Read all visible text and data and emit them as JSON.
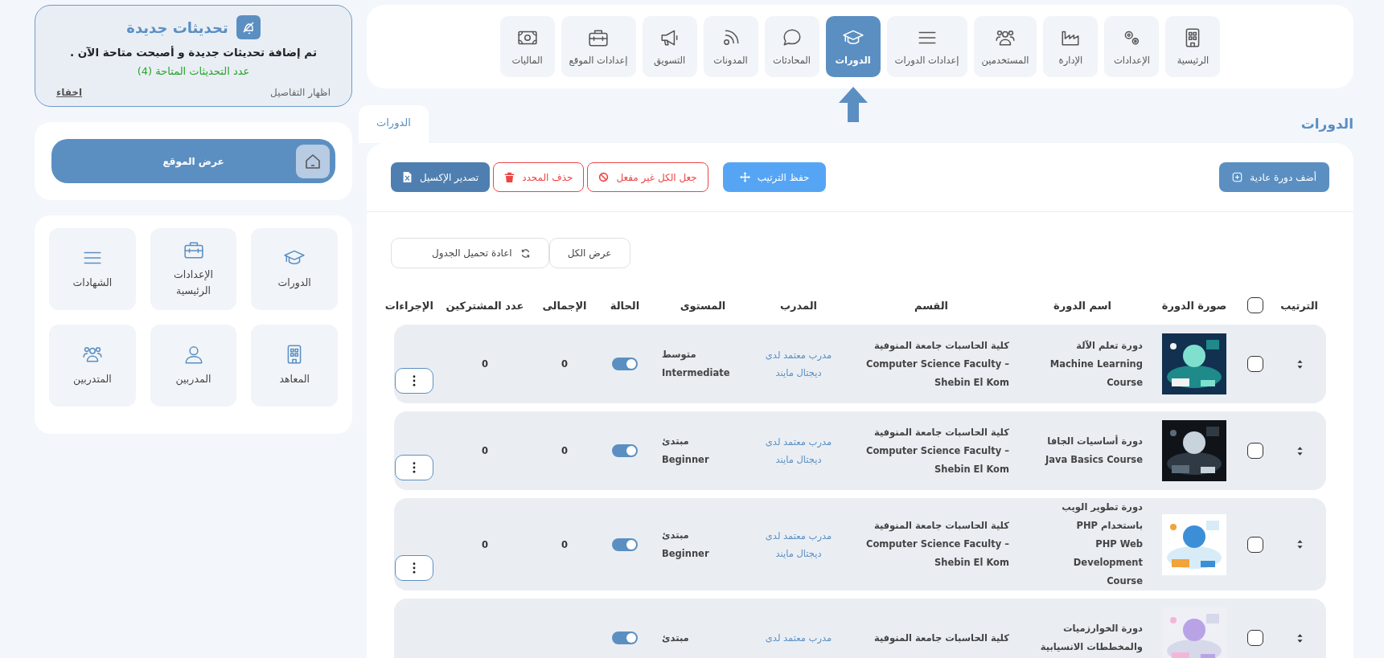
{
  "nav": [
    {
      "label": "الرئيسية",
      "selected": false
    },
    {
      "label": "الإعدادات",
      "selected": false
    },
    {
      "label": "الإدارة",
      "selected": false
    },
    {
      "label": "المستخدمين",
      "selected": false
    },
    {
      "label": "إعدادات الدورات",
      "selected": false
    },
    {
      "label": "الدورات",
      "selected": true
    },
    {
      "label": "المحادثات",
      "selected": false
    },
    {
      "label": "المدونات",
      "selected": false
    },
    {
      "label": "التسويق",
      "selected": false
    },
    {
      "label": "إعدادات الموقع",
      "selected": false
    },
    {
      "label": "الماليات",
      "selected": false
    }
  ],
  "page_title": "الدورات",
  "breadcrumb_tab": "الدورات",
  "toolbar": {
    "add": "أضف دورة عادية",
    "save_order": "حفظ الترتيب",
    "disable_all": "جعل الكل غير مفعل",
    "delete_selected": "حذف المحدد",
    "export": "تصدير الإكسيل"
  },
  "filters": {
    "show_all": "عرض الكل",
    "reload": "اعادة تحميل الجدول"
  },
  "table": {
    "columns": [
      "الترتيب",
      "صورة الدورة",
      "اسم الدورة",
      "القسم",
      "المدرب",
      "المستوى",
      "الحالة",
      "الإجمالى",
      "عدد المشتركين",
      "الإجراءات"
    ],
    "header_checked": false,
    "rows": [
      {
        "checked": false,
        "image": {
          "kind": "picture"
        },
        "name": [
          "دورة تعلم الآلة",
          "Machine Learning Course"
        ],
        "department": [
          "كلية الحاسبات جامعة المنوفية",
          "Computer Science Faculty – Shebin El Kom"
        ],
        "trainer": "مدرب معتمد لدى ديجتال مايند",
        "level": [
          "متوسط",
          "Intermediate"
        ],
        "on": true,
        "total": "0",
        "participants": "0"
      },
      {
        "checked": false,
        "image": {
          "kind": "picture"
        },
        "name": [
          "دورة أساسيات الجافا",
          "Java Basics Course"
        ],
        "department": [
          "كلية الحاسبات جامعة المنوفية",
          "Computer Science Faculty – Shebin El Kom"
        ],
        "trainer": "مدرب معتمد لدى ديجتال مايند",
        "level": [
          "مبتدئ",
          "Beginner"
        ],
        "on": true,
        "total": "0",
        "participants": "0"
      },
      {
        "checked": false,
        "image": {
          "kind": "picture"
        },
        "name": [
          "دورة تطوير الويب باستخدام PHP",
          "PHP Web Development Course"
        ],
        "department": [
          "كلية الحاسبات جامعة المنوفية",
          "Computer Science Faculty – Shebin El Kom"
        ],
        "trainer": "مدرب معتمد لدى ديجتال مايند",
        "level": [
          "مبتدئ",
          "Beginner"
        ],
        "on": true,
        "total": "0",
        "participants": "0"
      },
      {
        "checked": false,
        "image": {
          "kind": "picture"
        },
        "name": [
          "دورة الخوارزميات والمخططات الانسيابية"
        ],
        "department": [
          "كلية الحاسبات جامعة المنوفية"
        ],
        "trainer": "مدرب معتمد لدى",
        "level": [
          "مبتدئ"
        ],
        "on": true
      }
    ]
  },
  "updates": {
    "title": "تحديثات جديدة",
    "message": "تم إضافة تحديثات جديدة و أصبحت متاحة الآن .",
    "count": "عدد التحديثات المتاحة (4)",
    "details": "اظهار التفاصيل",
    "hide": "اخفاء"
  },
  "view_site": "عرض الموقع",
  "shortcuts": [
    "الدورات",
    "الإعدادات الرئيسية",
    "الشهادات",
    "المعاهد",
    "المدربين",
    "المتدربين"
  ]
}
